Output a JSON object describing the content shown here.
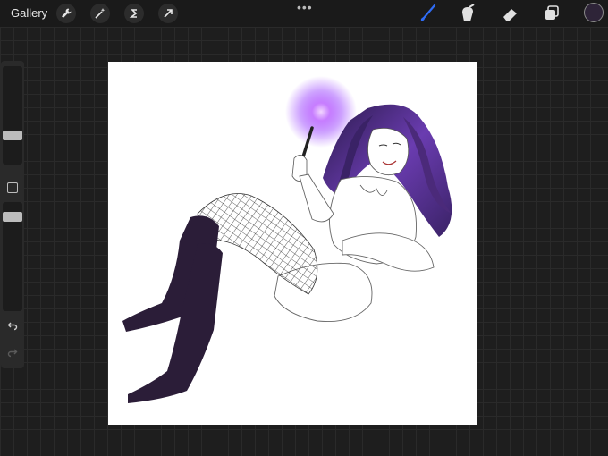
{
  "toolbar": {
    "gallery_label": "Gallery",
    "left_icons": [
      "wrench-icon",
      "magic-wand-icon",
      "selection-icon",
      "transform-arrow-icon"
    ],
    "more_label": "•••",
    "right_tools": [
      "brush-icon",
      "smudge-icon",
      "eraser-icon",
      "layers-icon"
    ],
    "active_tool": "brush-icon",
    "current_color": "#2e2438",
    "accent_color": "#2f6cf5"
  },
  "sidebar": {
    "brush_size_level": 0.2,
    "opacity_level": 0.42,
    "icons": [
      "modify-square-icon",
      "undo-icon",
      "redo-icon"
    ]
  },
  "canvas": {
    "artwork": "character-illustration",
    "glow_color": "#b05cff",
    "hair_color": "#4b2a7a",
    "boot_color": "#2b1d38"
  }
}
